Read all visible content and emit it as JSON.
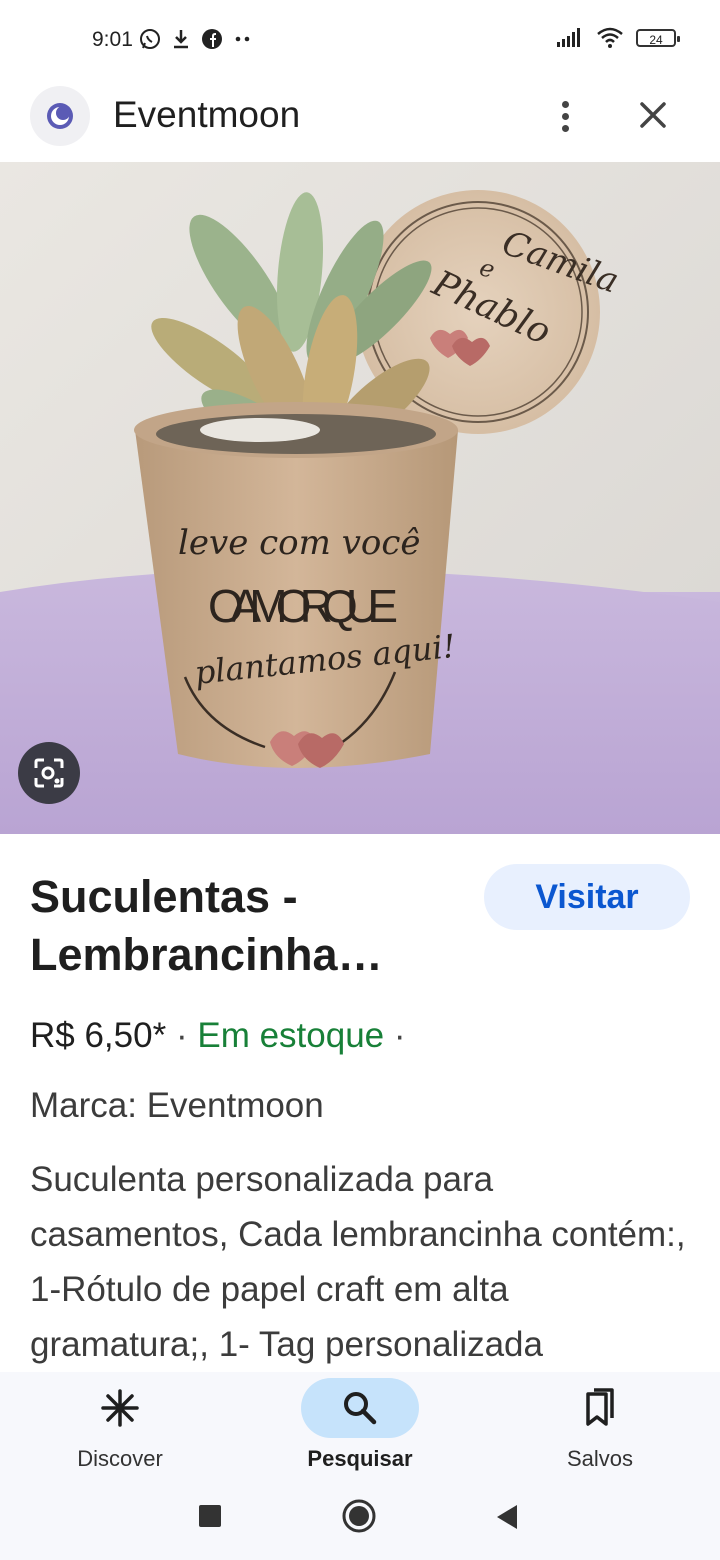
{
  "status_bar": {
    "time": "9:01",
    "battery": "24",
    "icons_left": [
      "whatsapp-icon",
      "download-icon",
      "facebook-icon",
      "more-dots-icon"
    ],
    "icons_right": [
      "signal-icon",
      "wifi-icon",
      "battery-icon"
    ]
  },
  "header": {
    "title": "Eventmoon",
    "logo_icon": "moon-logo-icon",
    "menu_icon": "more-vert-icon",
    "close_icon": "close-icon"
  },
  "hero": {
    "tag_text": [
      "Camila",
      "e",
      "Phablo"
    ],
    "cup_text": [
      "leve com você",
      "O AMOR QUE",
      "plantamos aqui!"
    ],
    "lens_icon": "google-lens-icon"
  },
  "product": {
    "title": "Suculentas - Lembrancinha…",
    "visit_label": "Visitar",
    "price": "R$ 6,50*",
    "separator": "·",
    "stock": "Em estoque",
    "brand": "Marca: Eventmoon",
    "description": "Suculenta personalizada para casamentos, Cada lembrancinha contém:, 1-Rótulo de papel craft em alta gramatura;, 1- Tag personalizada"
  },
  "bottom_nav": {
    "items": [
      {
        "label": "Discover",
        "icon": "discover-asterisk-icon",
        "active": false
      },
      {
        "label": "Pesquisar",
        "icon": "search-icon",
        "active": true
      },
      {
        "label": "Salvos",
        "icon": "collections-icon",
        "active": false
      }
    ]
  },
  "system_nav": {
    "icons": [
      "recents-square-icon",
      "home-circle-icon",
      "back-triangle-icon"
    ]
  },
  "colors": {
    "accent_blue": "#0b57d0",
    "visit_bg": "#e8f0fe",
    "stock_green": "#188038",
    "nav_active_bg": "#c6e3fb"
  }
}
